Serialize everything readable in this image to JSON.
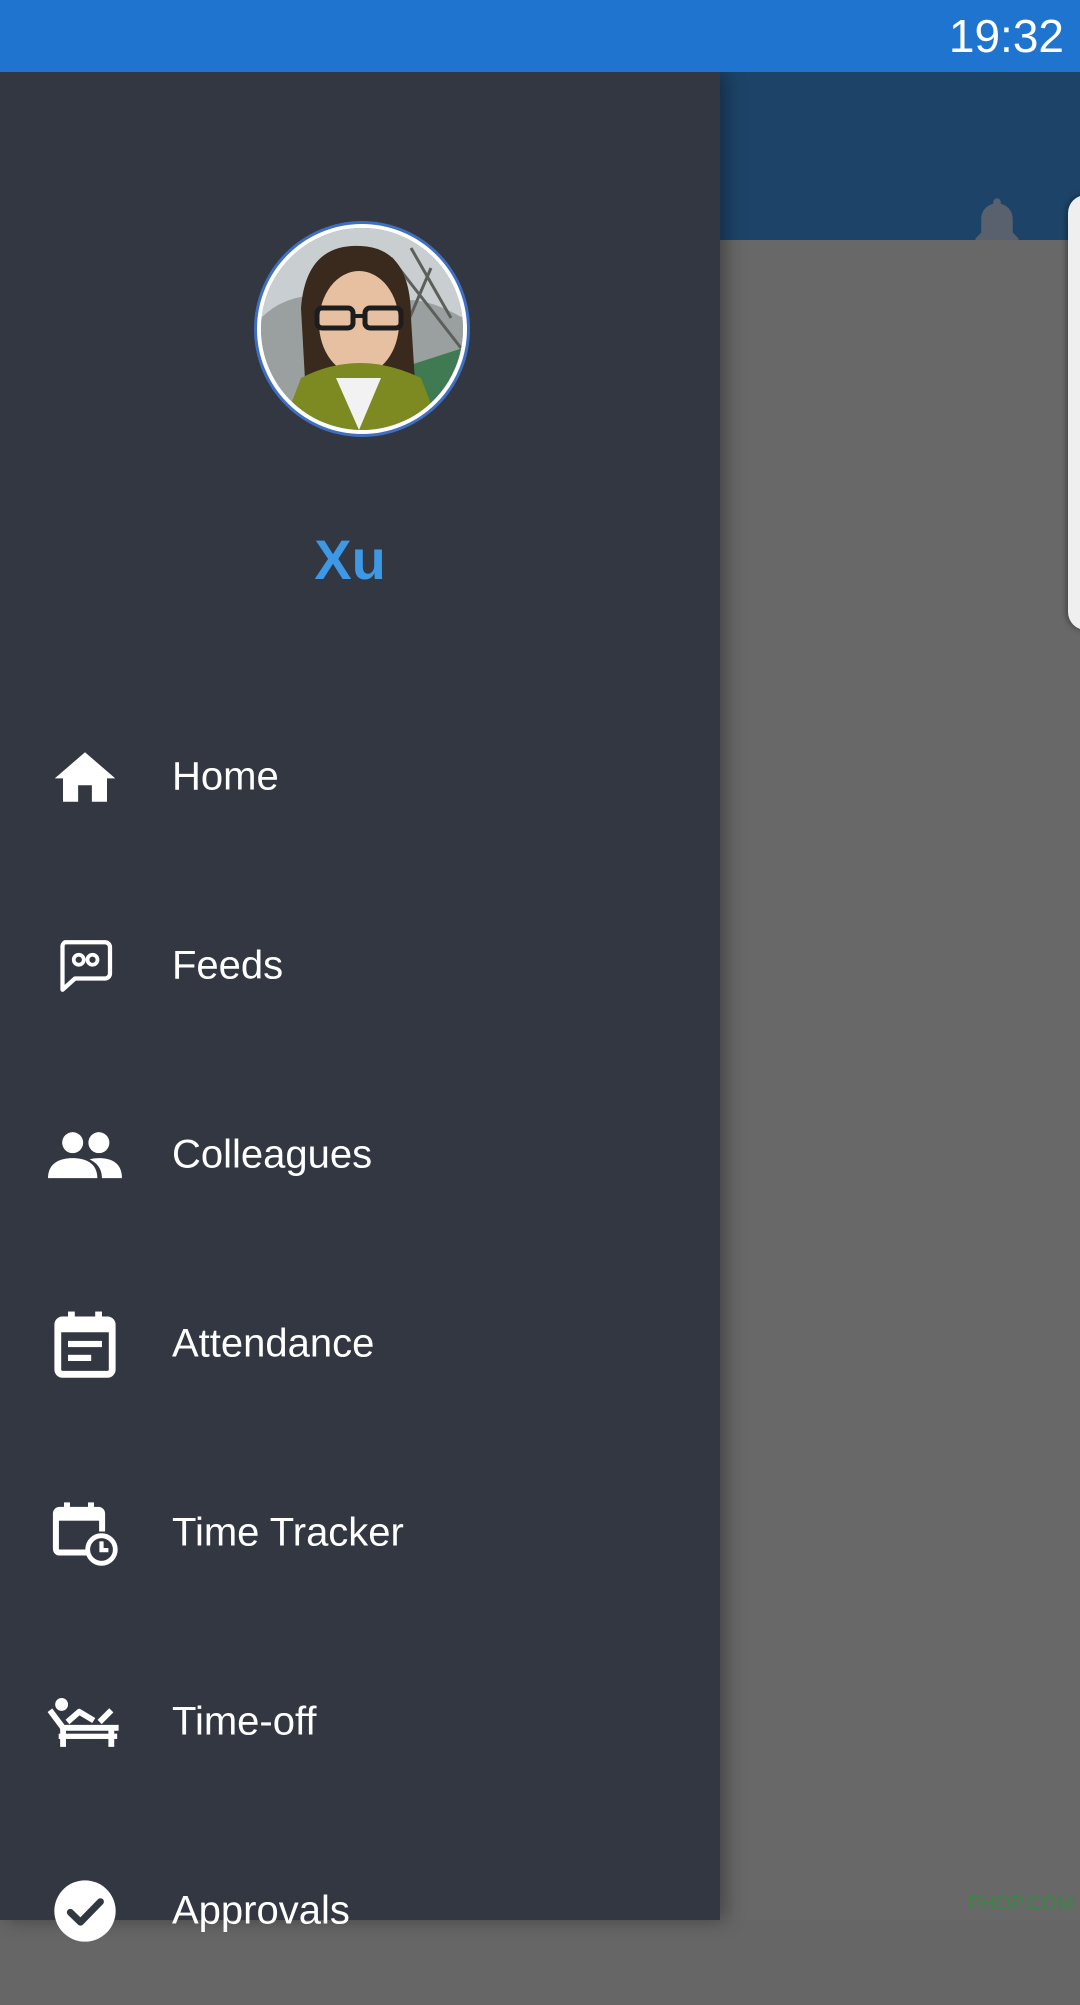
{
  "status_bar": {
    "time": "19:32"
  },
  "user": {
    "name": "Xu"
  },
  "menu": {
    "items": [
      {
        "label": "Home",
        "icon": "home-icon"
      },
      {
        "label": "Feeds",
        "icon": "chat-bubble-icon"
      },
      {
        "label": "Colleagues",
        "icon": "people-icon"
      },
      {
        "label": "Attendance",
        "icon": "calendar-note-icon"
      },
      {
        "label": "Time Tracker",
        "icon": "calendar-clock-icon"
      },
      {
        "label": "Time-off",
        "icon": "lounge-chair-icon"
      },
      {
        "label": "Approvals",
        "icon": "check-circle-icon"
      }
    ]
  },
  "watermark": "PHOP.COM",
  "colors": {
    "status_bar": "#1e74cf",
    "app_bar": "#1d4468",
    "drawer": "#333741",
    "accent": "#3d98e6",
    "scrim": "#686868"
  }
}
